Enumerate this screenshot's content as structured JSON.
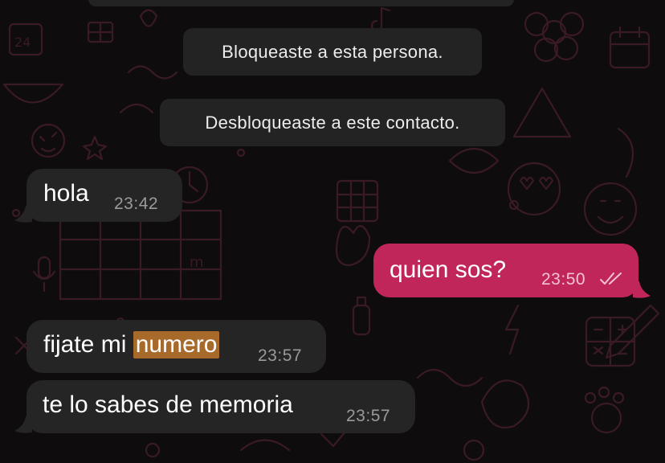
{
  "chat": {
    "system_messages": [
      {
        "text": "Bloqueaste a esta persona."
      },
      {
        "text": "Desbloqueaste a este contacto."
      }
    ],
    "messages": [
      {
        "direction": "incoming",
        "text": "hola",
        "time": "23:42"
      },
      {
        "direction": "outgoing",
        "text": "quien sos?",
        "time": "23:50",
        "status": "read"
      },
      {
        "direction": "incoming",
        "text_before": "fijate mi ",
        "highlighted": "numero",
        "time": "23:57"
      },
      {
        "direction": "incoming",
        "text": "te lo sabes de memoria",
        "time": "23:57"
      }
    ]
  },
  "colors": {
    "background": "#0e0c0d",
    "wallpaper_doodles": "#3a1a26",
    "incoming_bubble": "#252525",
    "outgoing_bubble": "#c1265a",
    "system_bubble": "#232323",
    "search_highlight": "#a86a2a",
    "text": "#ffffff",
    "timestamp_incoming": "#9a9a9a",
    "timestamp_outgoing": "#f3c2d3"
  },
  "icons": {
    "wallpaper": "doodle-pattern-icon",
    "read_receipt": "double-check-icon"
  }
}
